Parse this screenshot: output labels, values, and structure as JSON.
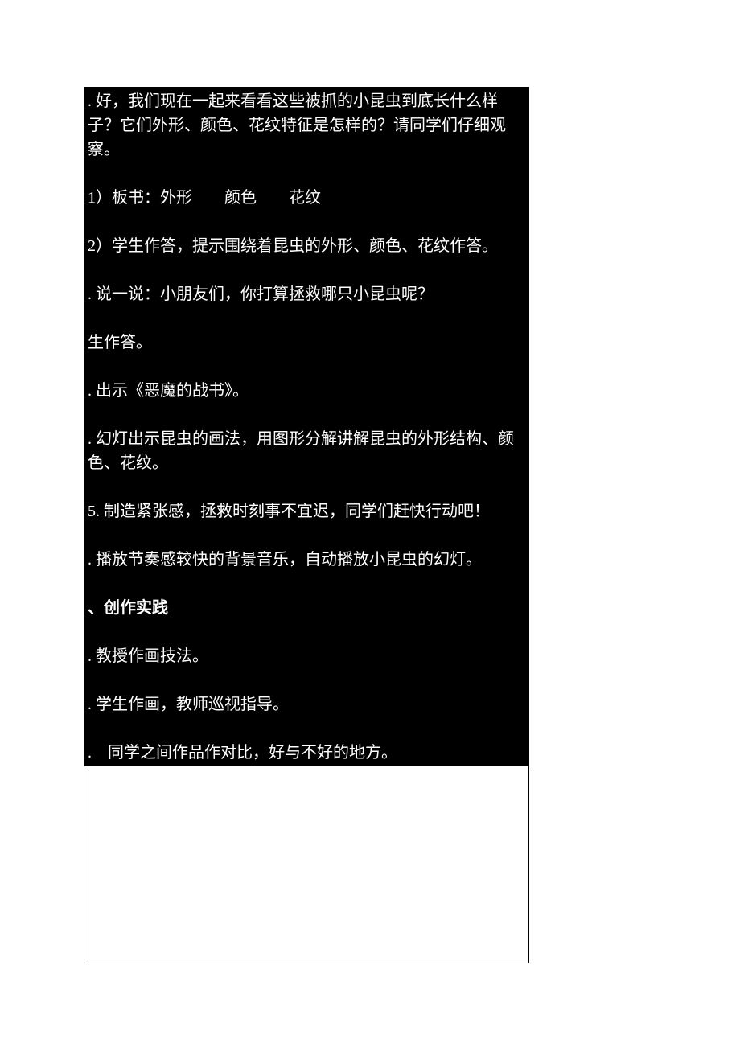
{
  "lines": {
    "l1": ". 好，我们现在一起来看看这些被抓的小昆虫到底长什么样子？它们外形、颜色、花纹特征是怎样的？请同学们仔细观察。",
    "l2": "1）板书：外形　　颜色　　花纹",
    "l3": "2）学生作答，提示围绕着昆虫的外形、颜色、花纹作答。",
    "l4": ". 说一说：小朋友们，你打算拯救哪只小昆虫呢？",
    "l5": "生作答。",
    "l6": ". 出示《恶魔的战书》。",
    "l7": ". 幻灯出示昆虫的画法，用图形分解讲解昆虫的外形结构、颜色、花纹。",
    "l8": "5. 制造紧张感，拯救时刻事不宜迟，同学们赶快行动吧！",
    "l9": ". 播放节奏感较快的背景音乐，自动播放小昆虫的幻灯。",
    "l10": "、创作实践",
    "l11": ". 教授作画技法。",
    "l12": ". 学生作画，教师巡视指导。",
    "l13": ".　同学之间作品作对比，好与不好的地方。"
  }
}
